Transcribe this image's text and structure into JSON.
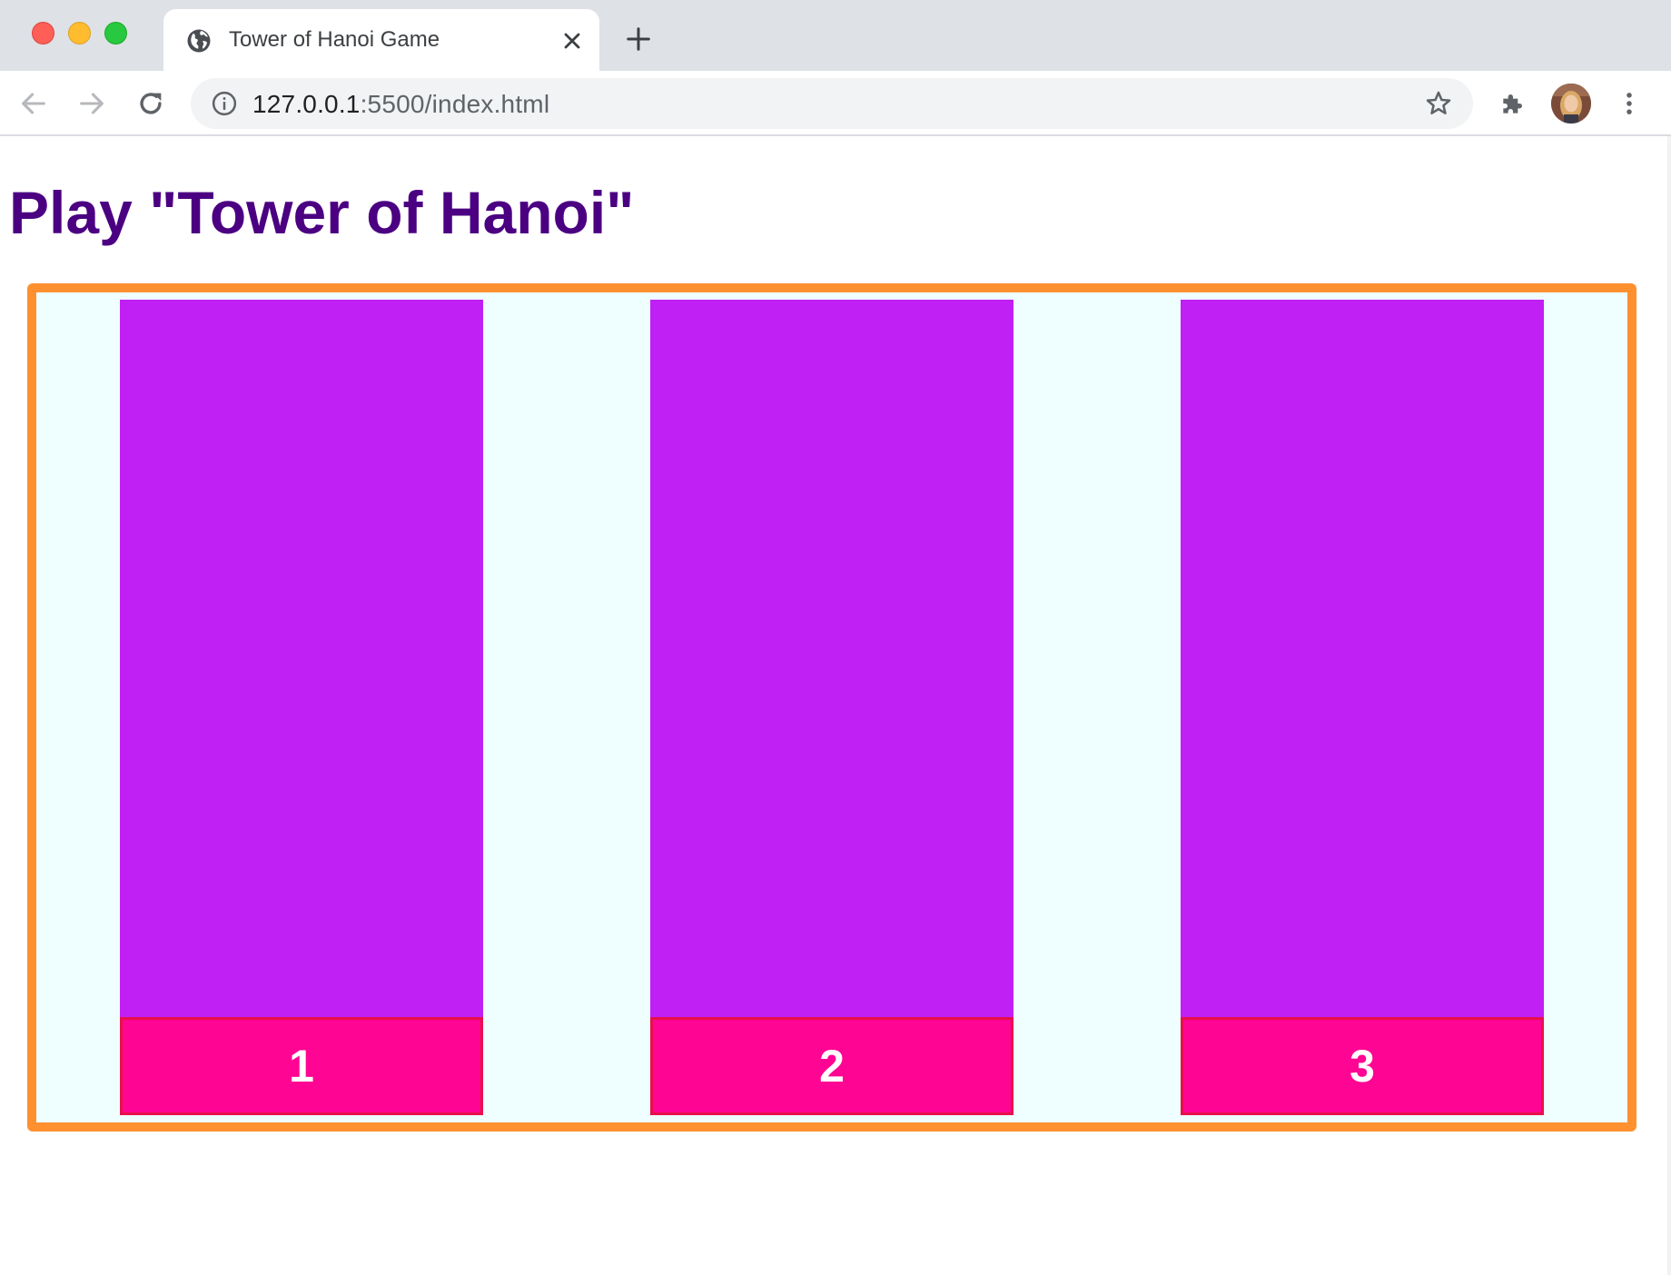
{
  "window": {
    "controls": [
      "close",
      "minimize",
      "maximize"
    ]
  },
  "tabs": [
    {
      "title": "Tower of Hanoi Game",
      "icon": "globe-icon",
      "active": true
    }
  ],
  "toolbar": {
    "url_host": "127.0.0.1",
    "url_rest": ":5500/index.html"
  },
  "page": {
    "title": "Play \"Tower of Hanoi\""
  },
  "game": {
    "towers": [
      {
        "label": "1"
      },
      {
        "label": "2"
      },
      {
        "label": "3"
      }
    ]
  },
  "colors": {
    "title": "#4b0082",
    "board_border": "#ff9030",
    "board_background": "#efffff",
    "tower": "#c020f4",
    "base": "#ff0593",
    "base_border": "#e8104a",
    "base_text": "#ffffff"
  }
}
